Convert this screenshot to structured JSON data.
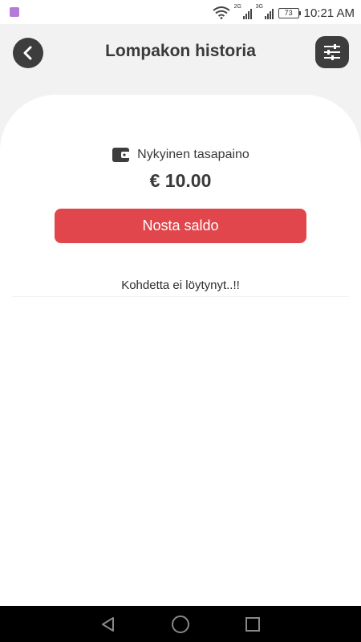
{
  "status_bar": {
    "time": "10:21 AM",
    "battery": "73",
    "network_1": "2G",
    "network_2": "3G"
  },
  "header": {
    "title": "Lompakon historia",
    "back_icon": "chevron-left-icon",
    "filter_icon": "sliders-icon"
  },
  "balance": {
    "label": "Nykyinen tasapaino",
    "amount": "€ 10.00",
    "icon": "wallet-icon"
  },
  "actions": {
    "withdraw_label": "Nosta saldo"
  },
  "history": {
    "empty_message": "Kohdetta ei löytynyt..!!"
  },
  "colors": {
    "accent": "#e0464b",
    "dark": "#3d3d3d"
  }
}
